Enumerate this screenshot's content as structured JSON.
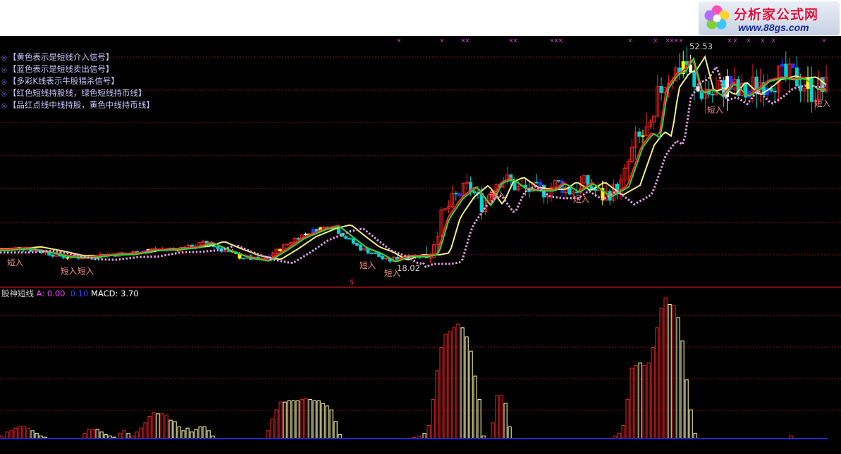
{
  "logo": {
    "title": "分析家公式网",
    "url": "www.88gs.com"
  },
  "legend": [
    "【黄色表示是短线介入信号】",
    "【蓝色表示是短线卖出信号】",
    "【多彩K线表示牛股猎杀信号】",
    "【红色短线持股线，绿色短线持币线】",
    "【品红点线中线持股，黄色中线持币线】"
  ],
  "short_label": "短入",
  "price_high_label": "52.53",
  "price_low_label": "18.02",
  "indicator": {
    "name": "股神短线",
    "a_text": "A: 0.00",
    "b_text": "0.10",
    "macd_text": "MACD: 3.70",
    "dollar": "$"
  },
  "colors": {
    "background": "#000000",
    "grid": "#7a1414",
    "up": "#ff2020",
    "down": "#00d2d2",
    "buy_signal": "#ffff00",
    "sell_signal": "#3030ff",
    "short_hold_line": "#ff2a2a",
    "short_cash_line": "#27d93a",
    "mid_hold_dots": "#ff70ff",
    "mid_cash_line": "#f2f280",
    "hist_red": "#e02020",
    "hist_yellow": "#f4f0a0",
    "baseline": "#2020ff",
    "accent_marks": "#ff50ff"
  },
  "chart_data": {
    "type": "line",
    "title": "",
    "price_path": [
      [
        0,
        21.5
      ],
      [
        30,
        21.8
      ],
      [
        60,
        21.2
      ],
      [
        90,
        20.5
      ],
      [
        120,
        20.4
      ],
      [
        150,
        20.8
      ],
      [
        180,
        20.9
      ],
      [
        210,
        21.5
      ],
      [
        240,
        21.6
      ],
      [
        270,
        21.9
      ],
      [
        290,
        22.6
      ],
      [
        310,
        21.7
      ],
      [
        340,
        20.5
      ],
      [
        370,
        19.9
      ],
      [
        395,
        21.5
      ],
      [
        420,
        23.3
      ],
      [
        450,
        24.6
      ],
      [
        470,
        25.1
      ],
      [
        490,
        23.4
      ],
      [
        510,
        21.8
      ],
      [
        530,
        21.0
      ],
      [
        550,
        19.8
      ],
      [
        570,
        20.6
      ],
      [
        595,
        20.6
      ],
      [
        610,
        20.9
      ],
      [
        625,
        26.2
      ],
      [
        645,
        29.3
      ],
      [
        665,
        31.0
      ],
      [
        685,
        28.1
      ],
      [
        700,
        31.5
      ],
      [
        715,
        32.2
      ],
      [
        735,
        30.7
      ],
      [
        755,
        30.4
      ],
      [
        775,
        30.4
      ],
      [
        790,
        31.5
      ],
      [
        810,
        30.2
      ],
      [
        830,
        31.5
      ],
      [
        855,
        29.5
      ],
      [
        880,
        31.0
      ],
      [
        900,
        37.0
      ],
      [
        915,
        39.0
      ],
      [
        925,
        38.3
      ],
      [
        935,
        45.5
      ],
      [
        950,
        47.8
      ],
      [
        960,
        48.2
      ],
      [
        972,
        50.2
      ],
      [
        985,
        45.0
      ],
      [
        1000,
        45.5
      ],
      [
        1015,
        44.5
      ],
      [
        1030,
        46.5
      ],
      [
        1050,
        44.5
      ],
      [
        1065,
        45.5
      ],
      [
        1080,
        46.8
      ],
      [
        1100,
        47.3
      ],
      [
        1115,
        47.0
      ],
      [
        1130,
        47.2
      ],
      [
        1150,
        45.5
      ],
      [
        1175,
        45.5
      ]
    ],
    "price_high": 52.53,
    "price_low": 18.02,
    "short_signals_x": [
      22,
      98,
      122,
      522,
      557,
      706,
      825,
      1015,
      1167
    ],
    "histogram": [
      [
        0,
        0.02,
        "r"
      ],
      [
        8,
        0.05,
        "r"
      ],
      [
        14,
        0.06,
        "r"
      ],
      [
        20,
        0.08,
        "r"
      ],
      [
        26,
        0.09,
        "r"
      ],
      [
        32,
        0.09,
        "r"
      ],
      [
        38,
        0.08,
        "r"
      ],
      [
        44,
        0.06,
        "y"
      ],
      [
        50,
        0.04,
        "y"
      ],
      [
        56,
        0.02,
        "y"
      ],
      [
        62,
        0.01,
        "y"
      ],
      [
        118,
        0.04,
        "r"
      ],
      [
        124,
        0.07,
        "r"
      ],
      [
        130,
        0.07,
        "r"
      ],
      [
        136,
        0.07,
        "y"
      ],
      [
        142,
        0.05,
        "y"
      ],
      [
        148,
        0.03,
        "y"
      ],
      [
        154,
        0.02,
        "y"
      ],
      [
        160,
        0.01,
        "y"
      ],
      [
        168,
        0.04,
        "r"
      ],
      [
        174,
        0.06,
        "r"
      ],
      [
        180,
        0.04,
        "y"
      ],
      [
        186,
        0.02,
        "r"
      ],
      [
        192,
        0.05,
        "r"
      ],
      [
        198,
        0.08,
        "r"
      ],
      [
        204,
        0.12,
        "r"
      ],
      [
        210,
        0.17,
        "r"
      ],
      [
        216,
        0.2,
        "r"
      ],
      [
        222,
        0.19,
        "y"
      ],
      [
        228,
        0.19,
        "r"
      ],
      [
        234,
        0.18,
        "r"
      ],
      [
        240,
        0.14,
        "y"
      ],
      [
        246,
        0.13,
        "y"
      ],
      [
        252,
        0.09,
        "y"
      ],
      [
        258,
        0.06,
        "y"
      ],
      [
        264,
        0.08,
        "y"
      ],
      [
        270,
        0.05,
        "y"
      ],
      [
        276,
        0.07,
        "y"
      ],
      [
        282,
        0.09,
        "y"
      ],
      [
        288,
        0.09,
        "y"
      ],
      [
        294,
        0.06,
        "y"
      ],
      [
        300,
        0.02,
        "y"
      ],
      [
        378,
        0.06,
        "r"
      ],
      [
        384,
        0.15,
        "r"
      ],
      [
        390,
        0.22,
        "r"
      ],
      [
        396,
        0.28,
        "r"
      ],
      [
        402,
        0.28,
        "y"
      ],
      [
        408,
        0.29,
        "y"
      ],
      [
        414,
        0.29,
        "y"
      ],
      [
        420,
        0.29,
        "y"
      ],
      [
        426,
        0.3,
        "r"
      ],
      [
        432,
        0.31,
        "r"
      ],
      [
        438,
        0.3,
        "y"
      ],
      [
        444,
        0.29,
        "y"
      ],
      [
        450,
        0.29,
        "y"
      ],
      [
        456,
        0.27,
        "y"
      ],
      [
        462,
        0.25,
        "y"
      ],
      [
        468,
        0.22,
        "y"
      ],
      [
        474,
        0.13,
        "y"
      ],
      [
        480,
        0.03,
        "y"
      ],
      [
        585,
        0.01,
        "r"
      ],
      [
        592,
        0.02,
        "r"
      ],
      [
        600,
        0.04,
        "y"
      ],
      [
        606,
        0.1,
        "r"
      ],
      [
        612,
        0.3,
        "r"
      ],
      [
        618,
        0.52,
        "r"
      ],
      [
        624,
        0.7,
        "r"
      ],
      [
        630,
        0.8,
        "r"
      ],
      [
        636,
        0.82,
        "r"
      ],
      [
        642,
        0.85,
        "r"
      ],
      [
        648,
        0.88,
        "r"
      ],
      [
        654,
        0.85,
        "y"
      ],
      [
        660,
        0.78,
        "y"
      ],
      [
        666,
        0.67,
        "y"
      ],
      [
        672,
        0.48,
        "y"
      ],
      [
        678,
        0.3,
        "y"
      ],
      [
        684,
        0.02,
        "y"
      ],
      [
        697,
        0.12,
        "r"
      ],
      [
        703,
        0.33,
        "r"
      ],
      [
        709,
        0.33,
        "r"
      ],
      [
        715,
        0.27,
        "y"
      ],
      [
        721,
        0.09,
        "y"
      ],
      [
        870,
        0.02,
        "r"
      ],
      [
        876,
        0.04,
        "r"
      ],
      [
        882,
        0.1,
        "r"
      ],
      [
        888,
        0.3,
        "r"
      ],
      [
        894,
        0.54,
        "r"
      ],
      [
        900,
        0.56,
        "r"
      ],
      [
        906,
        0.58,
        "y"
      ],
      [
        912,
        0.56,
        "r"
      ],
      [
        918,
        0.58,
        "r"
      ],
      [
        924,
        0.7,
        "r"
      ],
      [
        930,
        0.85,
        "r"
      ],
      [
        936,
        1.0,
        "r"
      ],
      [
        942,
        1.08,
        "r"
      ],
      [
        948,
        1.03,
        "y"
      ],
      [
        954,
        1.02,
        "r"
      ],
      [
        960,
        0.93,
        "y"
      ],
      [
        966,
        0.75,
        "y"
      ],
      [
        972,
        0.45,
        "y"
      ],
      [
        978,
        0.22,
        "y"
      ],
      [
        984,
        0.04,
        "y"
      ],
      [
        1120,
        0.02,
        "r"
      ]
    ]
  }
}
